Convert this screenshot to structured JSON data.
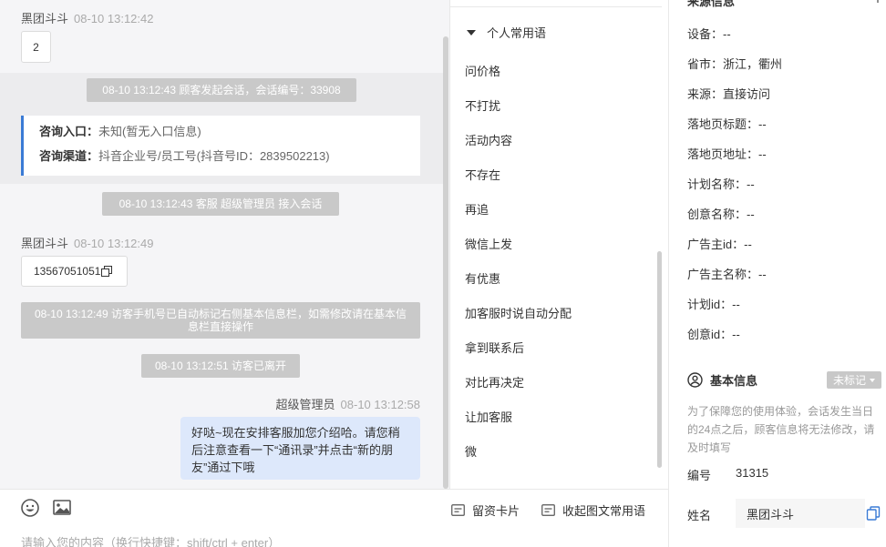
{
  "chat": {
    "messages": [
      {
        "sender": "黑团斗斗",
        "time": "08-10 13:12:42",
        "text": "2"
      },
      {
        "sender": "黑团斗斗",
        "time": "08-10 13:12:49",
        "text": "13567051051"
      }
    ],
    "system": {
      "session_start": "08-10 13:12:43 顾客发起会话，会话编号：33908",
      "agent_join": "08-10 13:12:43 客服 超级管理员 接入会话",
      "phone_marked": "08-10 13:12:49 访客手机号已自动标记右侧基本信息栏，如需修改请在基本信息栏直接操作",
      "visitor_left": "08-10 13:12:51 访客已离开"
    },
    "info_card": {
      "entry_label": "咨询入口：",
      "entry_value": "未知(暂无入口信息)",
      "channel_label": "咨询渠道：",
      "channel_value": "抖音企业号/员工号(抖音号ID：2839502213)"
    },
    "agent_reply": {
      "sender": "超级管理员",
      "time": "08-10 13:12:58",
      "text": "好哒~现在安排客服加您介绍哈。请您稍后注意查看一下“通讯录”并点击“新的朋友”通过下哦"
    }
  },
  "input": {
    "placeholder": "请输入您的内容（换行快捷键：shift/ctrl + enter）",
    "card_label": "留资卡片",
    "phrases_label": "收起图文常用语"
  },
  "phrases": {
    "header": "个人常用语",
    "items": [
      "问价格",
      "不打扰",
      "活动内容",
      "不存在",
      "再追",
      "微信上发",
      "有优惠",
      "加客服时说自动分配",
      "拿到联系后",
      "对比再决定",
      "让加客服",
      "微"
    ]
  },
  "info": {
    "source_header": "来源信息",
    "source_rows": [
      "设备：--",
      "省市：浙江，衢州",
      "来源：直接访问",
      "落地页标题：--",
      "落地页地址：--",
      "计划名称：--",
      "创意名称：--",
      "广告主id：--",
      "广告主名称：--",
      "计划id：--",
      "创意id：--"
    ],
    "basic_header": "基本信息",
    "tag_select": "未标记",
    "privacy_note": "为了保障您的使用体验，会话发生当日的24点之后，顾客信息将无法修改，请及时填写",
    "id_label": "编号",
    "id_value": "31315",
    "name_label": "姓名",
    "name_value": "黑团斗斗"
  },
  "colors": {
    "accent": "#3a7bd5",
    "agent_bubble": "#dde8fb",
    "system_badge": "#c9c9c9",
    "chat_bg": "#f5f5f7"
  }
}
